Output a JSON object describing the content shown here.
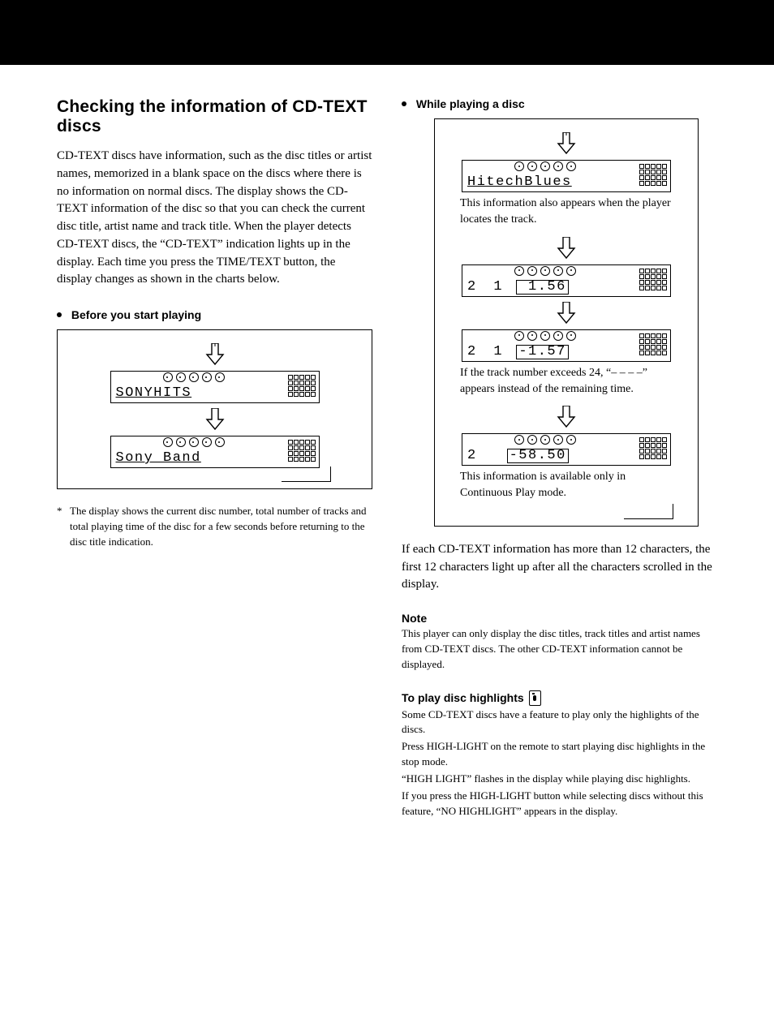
{
  "section_title": "Checking the information of CD-TEXT discs",
  "intro": "CD-TEXT discs have information, such as the disc titles or artist names, memorized in a blank space on the discs where there is no information on normal discs. The display shows the CD-TEXT information of the disc so that you can check the current disc title, artist name and track title. When the player detects CD-TEXT discs, the “CD-TEXT” indication lights up in the display. Each time you press the TIME/TEXT button, the display changes as shown in the charts below.",
  "before_head": "Before you start playing",
  "while_head": "While playing a disc",
  "screens": {
    "disc_title": "SONYHITS",
    "artist": "Sony Band",
    "track_title": "HitechBlues",
    "elapsed": {
      "disc": "2",
      "track": "1",
      "time": "1.56"
    },
    "remain": {
      "disc": "2",
      "track": "1",
      "time": "-1.57"
    },
    "disc_remain": {
      "disc": "2",
      "time": "-58.50"
    }
  },
  "footnote": "The display shows the current disc number, total number of tracks and total playing time of the disc for a few seconds before returning to the disc title indication.",
  "cap_track_appears": "This information also appears when the player locates the track.",
  "cap_exceeds24": "If the track number exceeds 24, “– – – –” appears instead of the remaining time.",
  "cap_continuous": "This information is available only in Continuous Play mode.",
  "scroll_para": "If each CD-TEXT information has more than 12 characters, the first 12 characters light up after all the characters scrolled in the display.",
  "note_head": "Note",
  "note_body": "This player can only display the disc titles, track titles and artist names from CD-TEXT discs. The other CD-TEXT information cannot be displayed.",
  "highlight_head": "To play disc highlights",
  "hl_p1": "Some CD-TEXT discs have a feature to play only the highlights of the discs.",
  "hl_p2": "Press HIGH-LIGHT on the remote to start playing disc highlights in the stop mode.",
  "hl_p3": "“HIGH LIGHT” flashes in the display while playing disc highlights.",
  "hl_p4": "If you press the HIGH-LIGHT button while selecting discs without this feature, “NO HIGHLIGHT” appears in the display."
}
